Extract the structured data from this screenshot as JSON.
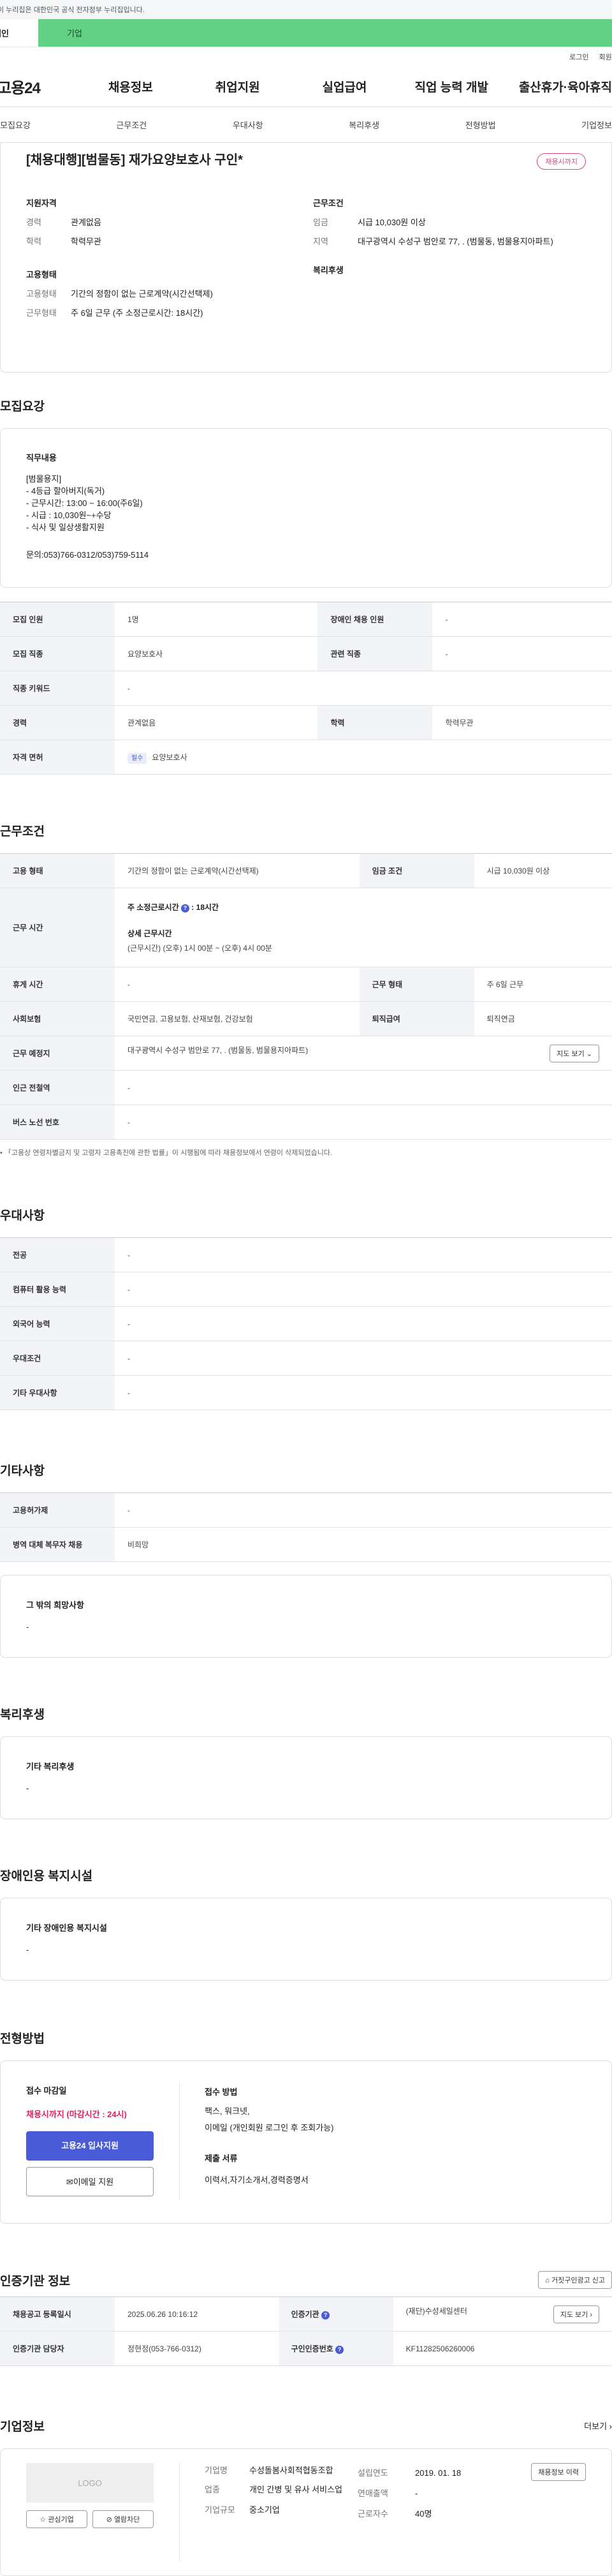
{
  "gov_banner": "이 누리집은 대한민국 공식 전자정부 누리집입니다.",
  "top_tabs": [
    "개인",
    "기업"
  ],
  "util": [
    "로그인",
    "회원가입"
  ],
  "logo": "고용24",
  "main_menu": [
    "채용정보",
    "취업지원",
    "실업급여",
    "직업 능력 개발",
    "출산휴가·육아휴직"
  ],
  "sub_menu": [
    "모집요강",
    "근무조건",
    "우대사항",
    "복리후생",
    "전형방법",
    "기업정보"
  ],
  "summary": {
    "title": "[채용대행][범물동] 재가요양보호사 구인*",
    "badge": "채용시까지",
    "qual_title": "지원자격",
    "career_label": "경력",
    "career": "관계없음",
    "edu_label": "학력",
    "edu": "학력무관",
    "cond_title": "근무조건",
    "wage_label": "임금",
    "wage": "시급 10,030원 이상",
    "region_label": "지역",
    "region": "대구광역시 수성구 범안로 77, . (범물동, 범물용지아파트)",
    "emp_title": "고용형태",
    "emp_label": "고용형태",
    "emp": "기간의 정함이 없는 근로계약(시간선택제)",
    "worktype_label": "근무형태",
    "worktype": "주 6일 근무 (주 소정근로시간: 18시간)",
    "welfare_title": "복리후생"
  },
  "recruit": {
    "title": "모집요강",
    "job_title": "직무내용",
    "job_lines": [
      "[범물용지]",
      "- 4등급 할아버지(독거)",
      "- 근무시간: 13:00 ~ 16:00(주6일)",
      "- 시급 : 10,030원~+수당",
      "- 식사 및 일상생활지원"
    ],
    "contact": "문의:053)766-0312/053)759-5114",
    "rows": {
      "count_l": "모집 인원",
      "count": "1명",
      "disabled_l": "장애인 채용 인원",
      "disabled": "-",
      "job_l": "모집 직종",
      "job": "요양보호사",
      "related_l": "관련 직종",
      "related": "-",
      "kw_l": "직종 키워드",
      "kw": "-",
      "career_l": "경력",
      "career": "관계없음",
      "edu_l": "학력",
      "edu": "학력무관",
      "license_l": "자격 면허",
      "license_badge": "필수",
      "license": "요양보호사"
    }
  },
  "cond": {
    "title": "근무조건",
    "emp_l": "고용 형태",
    "emp": "기간의 정함이 없는 근로계약(시간선택제)",
    "wage_l": "임금 조건",
    "wage": "시급 10,030원 이상",
    "time_l": "근무 시간",
    "week_hours_label": "주 소정근로시간",
    "week_hours": "18시간",
    "detail_title": "상세 근무시간",
    "detail": "(근무시간) (오후) 1시 00분 ~ (오후) 4시 00분",
    "rest_l": "휴게 시간",
    "rest": "-",
    "form_l": "근무 형태",
    "form": "주 6일 근무",
    "ins_l": "사회보험",
    "ins": "국민연금, 고용보험, 산재보험, 건강보험",
    "pension_l": "퇴직급여",
    "pension": "퇴직연금",
    "place_l": "근무 예정지",
    "place": "대구광역시 수성구 범안로 77, . (범물동, 범물용지아파트)",
    "map_btn": "지도 보기",
    "subway_l": "인근 전철역",
    "subway": "-",
    "bus_l": "버스 노선 번호",
    "bus": "-",
    "note": "「고용상 연령차별금지 및 고령자 고용촉진에 관한 법률」이 시행됨에 따라 채용정보에서 연령이 삭제되었습니다."
  },
  "pref": {
    "title": "우대사항",
    "rows": [
      [
        "전공",
        "-"
      ],
      [
        "컴퓨터 활용 능력",
        "-"
      ],
      [
        "외국어 능력",
        "-"
      ],
      [
        "우대조건",
        "-"
      ],
      [
        "기타 우대사항",
        "-"
      ]
    ]
  },
  "other": {
    "title": "기타사항",
    "rows": [
      [
        "고용허가제",
        "-"
      ],
      [
        "병역 대체 복무자 채용",
        "비희망"
      ]
    ],
    "box_title": "그 밖의 희망사항",
    "box_val": "-"
  },
  "welfare": {
    "title": "복리후생",
    "box_title": "기타 복리후생",
    "box_val": "-"
  },
  "facility": {
    "title": "장애인용 복지시설",
    "box_title": "기타 장애인용 복지시설",
    "box_val": "-"
  },
  "process": {
    "title": "전형방법",
    "deadline_l": "접수 마감일",
    "deadline": "채용시까지 (마감시간 : 24시)",
    "apply_btn": "고용24 입사지원",
    "email_btn": "이메일 지원",
    "method_l": "접수 방법",
    "method": "팩스, 워크넷,",
    "method2": "이메일 (개인회원 로그인 후 조회가능)",
    "docs_l": "제출 서류",
    "docs": "이력서,자기소개서,경력증명서"
  },
  "cert": {
    "title": "인증기관 정보",
    "report_btn": "거짓구인광고 신고",
    "reg_l": "채용공고 등록일시",
    "reg": "2025.06.26 10:16:12",
    "org_l": "인증기관",
    "org": "(재단)수성세일센터",
    "map_btn": "지도 보기",
    "mgr_l": "인증기관 담당자",
    "mgr": "정현정(053-766-0312)",
    "no_l": "구인인증번호",
    "no": "KF11282506260006"
  },
  "company": {
    "title": "기업정보",
    "more": "더보기",
    "logo": "LOGO",
    "fav_btn": "관심기업",
    "block_btn": "열람차단",
    "name_l": "기업명",
    "name": "수성돌봄사회적협동조합",
    "ind_l": "업종",
    "ind": "개인 간병 및 유사 서비스업",
    "size_l": "기업규모",
    "size": "중소기업",
    "est_l": "설립연도",
    "est": "2019. 01. 18",
    "sales_l": "연매출액",
    "sales": "-",
    "emp_l": "근로자수",
    "emp": "40명",
    "other_btn": "채용정보 이력"
  }
}
